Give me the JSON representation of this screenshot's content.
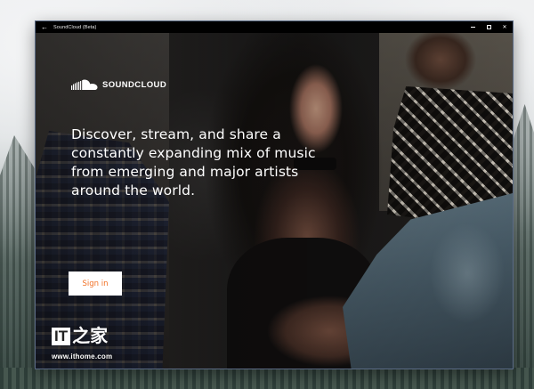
{
  "window": {
    "title": "SoundCloud (Beta)",
    "back_glyph": "←",
    "controls": [
      "minimize",
      "maximize",
      "close"
    ],
    "close_glyph": "✕"
  },
  "brand": {
    "name": "SOUNDCLOUD",
    "icon": "soundcloud-cloud-logo"
  },
  "hero": {
    "tagline": "Discover, stream, and share a constantly expanding mix of music from emerging and major artists around the world."
  },
  "actions": {
    "signin_label": "Sign in"
  },
  "watermark": {
    "logo_text_it": "IT",
    "logo_text_zh": "之家",
    "url": "www.ithome.com"
  },
  "colors": {
    "accent": "#f26f23",
    "titlebar": "#000000",
    "window_border": "#5a6a84"
  }
}
